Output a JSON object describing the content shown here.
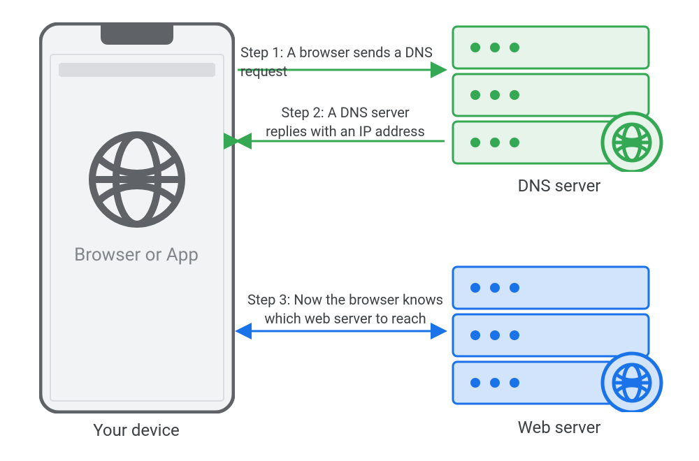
{
  "device": {
    "caption": "Your device",
    "app_label": "Browser or App"
  },
  "dns_server_label": "DNS server",
  "web_server_label": "Web server",
  "step1": "Step 1: A browser sends a DNS request",
  "step2a": "Step 2: A DNS server",
  "step2b": "replies with an IP address",
  "step3a": "Step 3: Now the browser knows",
  "step3b": "which web server to reach",
  "colors": {
    "green_stroke": "#34A853",
    "green_fill": "#E6F4EA",
    "blue_stroke": "#1A73E8",
    "blue_fill": "#D2E3FC",
    "phone_stroke": "#5F6368",
    "phone_fill": "#F1F3F4",
    "text": "#5F6368",
    "gray_icon": "#5F6368",
    "url_bar": "#DADCE0"
  }
}
